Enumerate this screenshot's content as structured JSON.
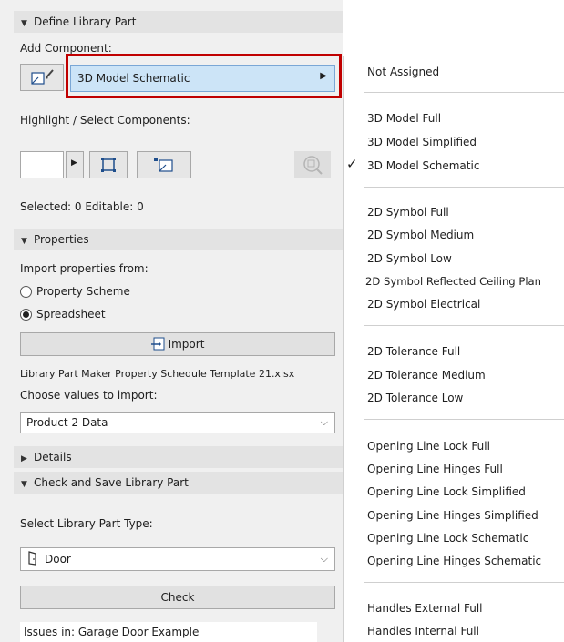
{
  "sections": {
    "define": "Define Library Part",
    "properties": "Properties",
    "details": "Details",
    "check_save": "Check and Save Library Part"
  },
  "add_component": {
    "label": "Add Component:",
    "value": "3D Model Schematic"
  },
  "highlight": {
    "label": "Highlight / Select Components:"
  },
  "selected_text": "Selected: 0 Editable: 0",
  "import": {
    "from_label": "Import properties from:",
    "options": [
      "Property Scheme",
      "Spreadsheet"
    ],
    "selected": "Spreadsheet",
    "button": "Import",
    "file": "Library Part Maker Property Schedule Template 21.xlsx",
    "choose_label": "Choose values to import:",
    "choose_value": "Product 2 Data"
  },
  "type": {
    "label": "Select Library Part Type:",
    "value": "Door"
  },
  "check_button": "Check",
  "issues": "Issues in: Garage Door Example",
  "menu": {
    "checked": "3D Model Schematic",
    "groups": [
      [
        "Not Assigned"
      ],
      [
        "3D Model Full",
        "3D Model Simplified",
        "3D Model Schematic"
      ],
      [
        "2D Symbol Full",
        "2D Symbol Medium",
        "2D Symbol Low",
        "2D Symbol Reflected Ceiling Plan",
        "2D Symbol Electrical"
      ],
      [
        "2D Tolerance Full",
        "2D Tolerance Medium",
        "2D Tolerance Low"
      ],
      [
        "Opening Line Lock Full",
        "Opening Line Hinges Full",
        "Opening Line Lock Simplified",
        "Opening Line Hinges Simplified",
        "Opening Line Lock Schematic",
        "Opening Line Hinges Schematic"
      ],
      [
        "Handles External Full",
        "Handles Internal Full"
      ]
    ]
  },
  "colors": {
    "highlight_box": "#c00000",
    "combo_selected": "#cce4f7"
  }
}
